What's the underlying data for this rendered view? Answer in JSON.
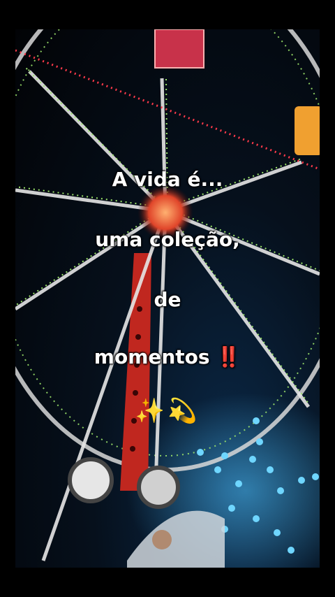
{
  "caption": {
    "line1": "A vida é...",
    "line2": "uma coleção,",
    "line3": "de",
    "line4": "momentos ‼️",
    "emoji": "✨💫"
  },
  "scene": {
    "subject": "ferris-wheel",
    "colors": {
      "background": "#000000",
      "lights_green": "#9be36a",
      "lights_red": "#ff3a4a",
      "tower": "#c0271f",
      "star_lights": "#4fc3ff"
    }
  }
}
